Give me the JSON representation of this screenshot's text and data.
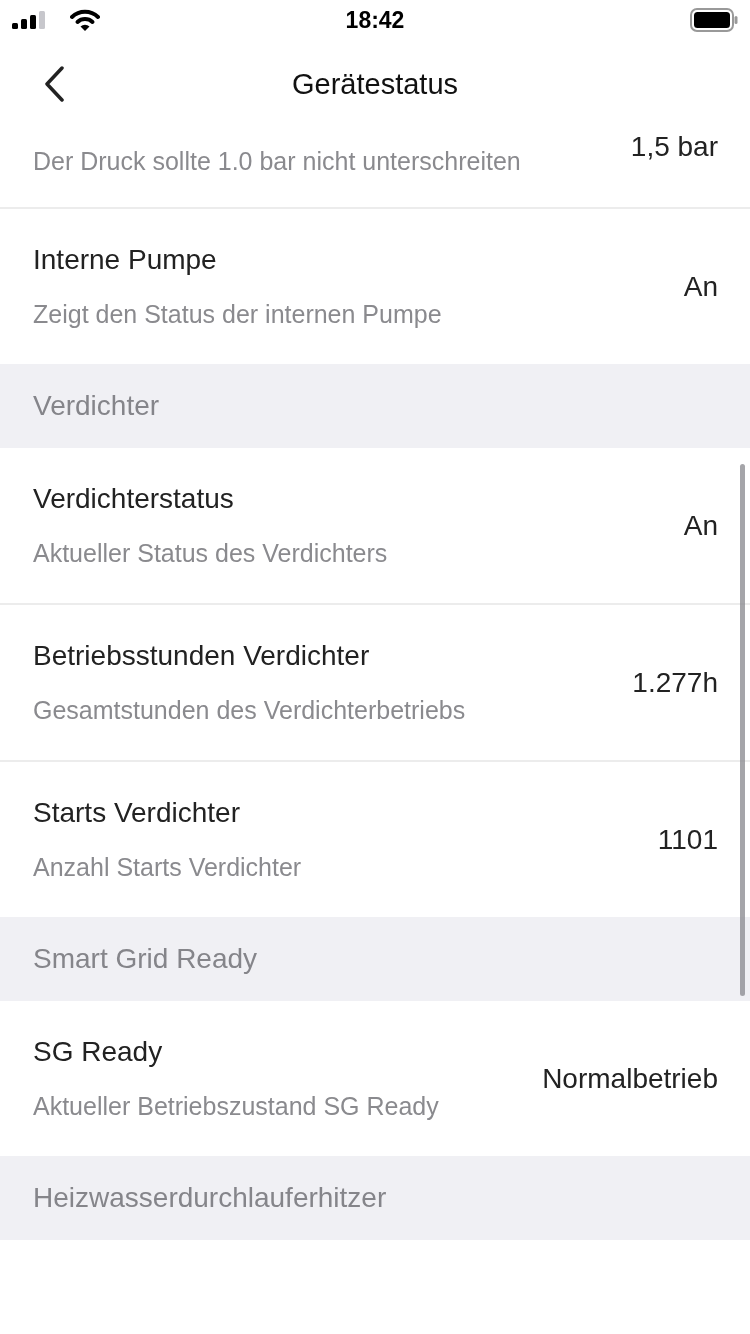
{
  "status_bar": {
    "time": "18:42"
  },
  "nav": {
    "title": "Gerätestatus"
  },
  "items": [
    {
      "kind": "row",
      "subtitle": "Der Druck sollte 1.0 bar nicht unterschreiten",
      "value": "1,5 bar"
    },
    {
      "kind": "row",
      "title": "Interne Pumpe",
      "subtitle": "Zeigt den Status der internen Pumpe",
      "value": "An"
    },
    {
      "kind": "header",
      "title": "Verdichter"
    },
    {
      "kind": "row",
      "title": "Verdichterstatus",
      "subtitle": "Aktueller Status des Verdichters",
      "value": "An"
    },
    {
      "kind": "row",
      "title": "Betriebsstunden Verdichter",
      "subtitle": "Gesamtstunden des Verdichterbetriebs",
      "value": "1.277h"
    },
    {
      "kind": "row",
      "title": "Starts Verdichter",
      "subtitle": "Anzahl Starts Verdichter",
      "value": "1101"
    },
    {
      "kind": "header",
      "title": "Smart Grid Ready"
    },
    {
      "kind": "row",
      "title": "SG Ready",
      "subtitle": "Aktueller Betriebszustand SG Ready",
      "value": "Normalbetrieb"
    },
    {
      "kind": "header",
      "title": "Heizwasserdurchlauferhitzer"
    }
  ]
}
